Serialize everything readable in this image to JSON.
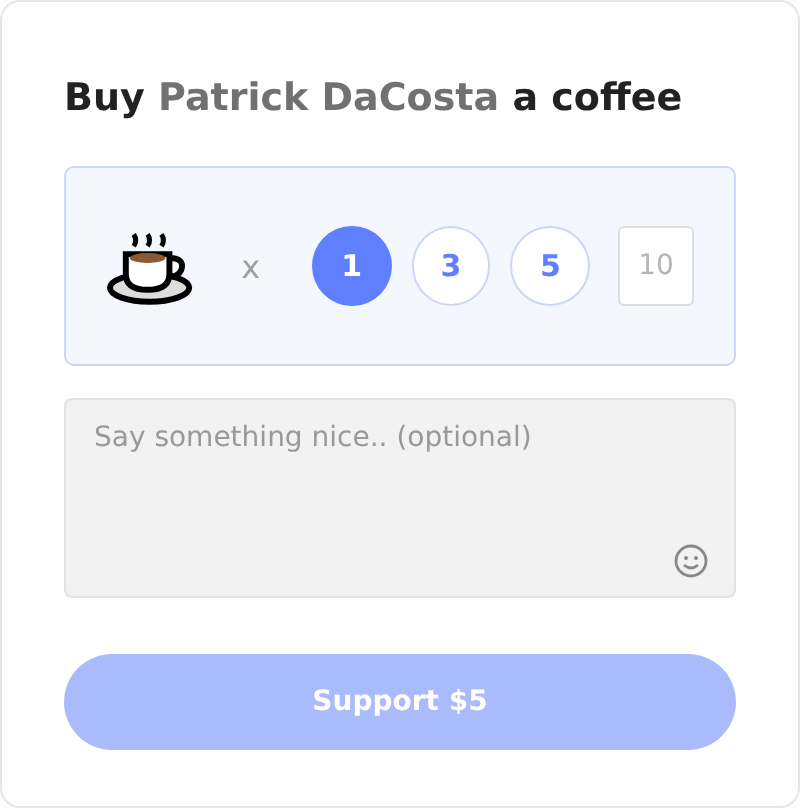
{
  "title": {
    "before": "Buy",
    "name": "Patrick DaCosta",
    "after": "a coffee"
  },
  "picker": {
    "multiplier": "x",
    "options": [
      {
        "label": "1",
        "selected": true
      },
      {
        "label": "3",
        "selected": false
      },
      {
        "label": "5",
        "selected": false
      }
    ],
    "custom": {
      "placeholder": "10"
    }
  },
  "message": {
    "placeholder": "Say something nice.. (optional)"
  },
  "submit": {
    "label": "Support $5",
    "disabled": true
  }
}
